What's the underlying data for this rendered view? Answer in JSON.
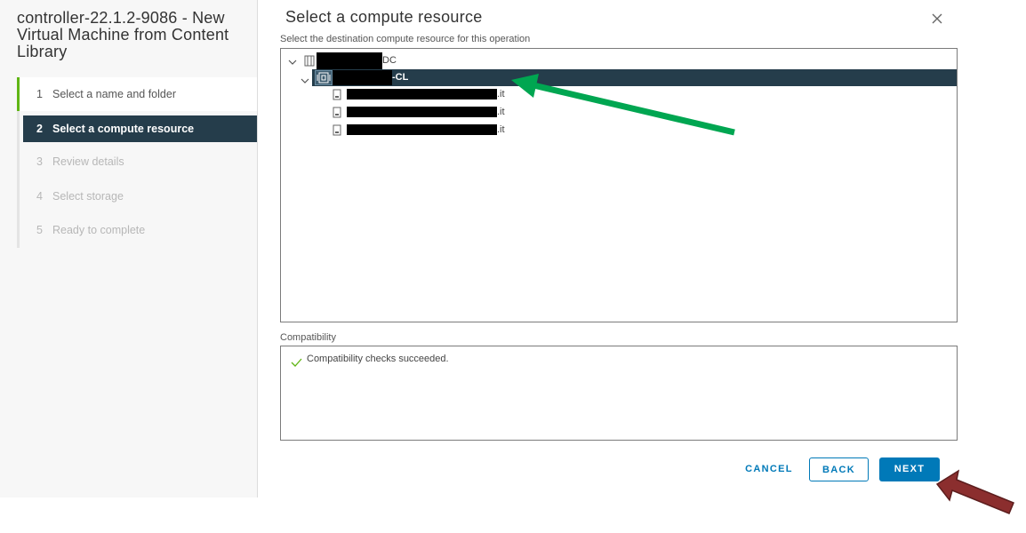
{
  "wizard": {
    "title": "controller-22.1.2-9086 - New Virtual Machine from Content Library",
    "steps": [
      {
        "num": "1",
        "label": "Select a name and folder",
        "state": "done"
      },
      {
        "num": "2",
        "label": "Select a compute resource",
        "state": "active"
      },
      {
        "num": "3",
        "label": "Review details",
        "state": "disabled"
      },
      {
        "num": "4",
        "label": "Select storage",
        "state": "disabled"
      },
      {
        "num": "5",
        "label": "Ready to complete",
        "state": "disabled"
      }
    ]
  },
  "main": {
    "title": "Select a compute resource",
    "subtitle": "Select the destination compute resource for this operation",
    "tree": {
      "datacenter_suffix": "DC",
      "cluster_suffix": "-CL",
      "hosts": [
        {
          "suffix": ".it"
        },
        {
          "suffix": ".it"
        },
        {
          "suffix": ".it"
        }
      ]
    },
    "compatibility": {
      "label": "Compatibility",
      "message": "Compatibility checks succeeded."
    }
  },
  "buttons": {
    "cancel": "CANCEL",
    "back": "BACK",
    "next": "NEXT"
  },
  "colors": {
    "accent": "#0079b8",
    "selected_bg": "#253d4b",
    "done_green": "#60b515",
    "annotation_green": "#00a651",
    "annotation_red": "#8b2e2e"
  },
  "icons": {
    "close": "close-icon",
    "chevron": "chevron-down-icon",
    "datacenter": "datacenter-icon",
    "cluster": "cluster-icon",
    "host": "host-icon",
    "check": "check-icon"
  }
}
